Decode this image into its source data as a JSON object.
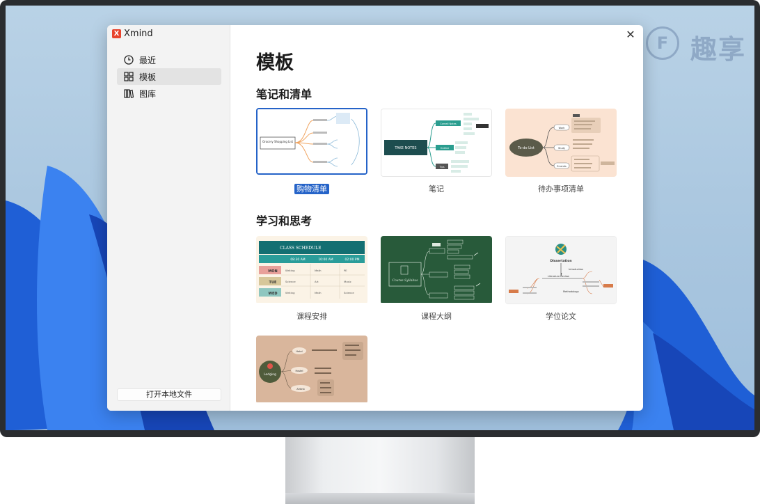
{
  "app": {
    "name": "Xmind",
    "logo_glyph": "X"
  },
  "watermark": {
    "glyph": "F",
    "text": "趣享"
  },
  "sidebar": {
    "items": [
      {
        "label": "最近",
        "icon": "clock-icon",
        "active": false
      },
      {
        "label": "模板",
        "icon": "grid-icon",
        "active": true
      },
      {
        "label": "图库",
        "icon": "library-icon",
        "active": false
      }
    ],
    "open_local": "打开本地文件"
  },
  "main": {
    "title": "模板",
    "sections": [
      {
        "title": "笔记和清单",
        "templates": [
          {
            "label": "购物清单",
            "selected": true,
            "center": "Grocery Shopping List"
          },
          {
            "label": "笔记",
            "selected": false,
            "center": "TAKE NOTES"
          },
          {
            "label": "待办事项清单",
            "selected": false,
            "center": "To-do List"
          }
        ]
      },
      {
        "title": "学习和思考",
        "templates": [
          {
            "label": "课程安排",
            "selected": false,
            "center": "CLASS SCHEDULE"
          },
          {
            "label": "课程大纲",
            "selected": false,
            "center": "Course Syllabus"
          },
          {
            "label": "学位论文",
            "selected": false,
            "center": "Dissertation"
          },
          {
            "label": "",
            "selected": false,
            "center": "Lodging"
          }
        ]
      }
    ]
  },
  "thumbnails": {
    "notes_branches": [
      "Cornell Notes",
      "Outline",
      "Tips"
    ],
    "todo_branches": [
      "Work",
      "Study",
      "Errands"
    ],
    "schedule": {
      "times": [
        "08:30 AM",
        "10:00 AM",
        "02:00 PM"
      ],
      "days": [
        "MON",
        "TUE",
        "WED"
      ],
      "cells": [
        [
          "Writing",
          "Math",
          "PE"
        ],
        [
          "Science",
          "Art",
          "Music"
        ],
        [
          "Writing",
          "Math",
          "Science"
        ]
      ]
    },
    "dissertation_branches": [
      "Introduction",
      "Literature Review",
      "Methodology"
    ],
    "lodging_branches": [
      "Hotel",
      "Hostel",
      "Airbnb"
    ]
  },
  "colors": {
    "accent": "#2563c8",
    "close": "#333333"
  }
}
